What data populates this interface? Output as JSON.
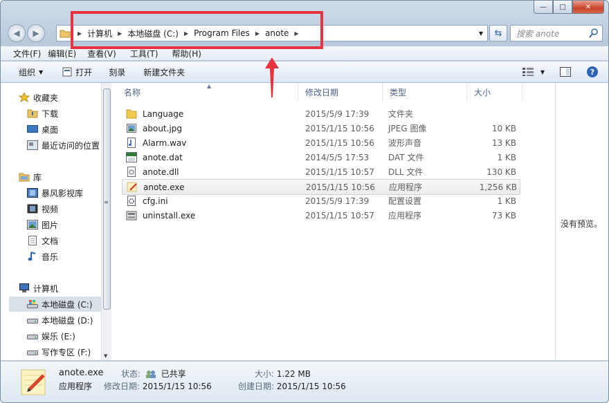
{
  "window": {
    "min": "—",
    "max": "□",
    "close": "✕"
  },
  "address": {
    "crumbs": [
      "计算机",
      "本地磁盘 (C:)",
      "Program Files",
      "anote"
    ]
  },
  "search": {
    "placeholder": "搜索 anote"
  },
  "menu": [
    "文件(F)",
    "编辑(E)",
    "查看(V)",
    "工具(T)",
    "帮助(H)"
  ],
  "toolbar": {
    "organize": "组织",
    "open": "打开",
    "burn": "刻录",
    "new_folder": "新建文件夹"
  },
  "nav": {
    "favorites": {
      "label": "收藏夹",
      "items": [
        "下载",
        "桌面",
        "最近访问的位置"
      ]
    },
    "libraries": {
      "label": "库",
      "items": [
        "暴风影视库",
        "视频",
        "图片",
        "文档",
        "音乐"
      ]
    },
    "computer": {
      "label": "计算机",
      "items": [
        "本地磁盘 (C:)",
        "本地磁盘 (D:)",
        "娱乐 (E:)",
        "写作专区 (F:)"
      ]
    }
  },
  "columns": [
    "名称",
    "修改日期",
    "类型",
    "大小"
  ],
  "files": [
    {
      "name": "Language",
      "date": "2015/5/9 17:39",
      "type": "文件夹",
      "size": "",
      "icon": "folder-icon"
    },
    {
      "name": "about.jpg",
      "date": "2015/1/15 10:56",
      "type": "JPEG 图像",
      "size": "10 KB",
      "icon": "image-file-icon"
    },
    {
      "name": "Alarm.wav",
      "date": "2015/1/15 10:56",
      "type": "波形声音",
      "size": "13 KB",
      "icon": "audio-file-icon"
    },
    {
      "name": "anote.dat",
      "date": "2014/5/5 17:53",
      "type": "DAT 文件",
      "size": "1 KB",
      "icon": "dat-file-icon"
    },
    {
      "name": "anote.dll",
      "date": "2015/1/15 10:57",
      "type": "DLL 文件",
      "size": "130 KB",
      "icon": "dll-file-icon"
    },
    {
      "name": "anote.exe",
      "date": "2015/1/15 10:56",
      "type": "应用程序",
      "size": "1,256 KB",
      "icon": "anote-app-icon"
    },
    {
      "name": "cfg.ini",
      "date": "2015/5/9 17:39",
      "type": "配置设置",
      "size": "1 KB",
      "icon": "ini-file-icon"
    },
    {
      "name": "uninstall.exe",
      "date": "2015/1/15 10:57",
      "type": "应用程序",
      "size": "73 KB",
      "icon": "uninstall-icon"
    }
  ],
  "preview": {
    "text": "没有预览。"
  },
  "status": {
    "filename": "anote.exe",
    "filetype": "应用程序",
    "state_label": "状态:",
    "state_value": "已共享",
    "modified_label": "修改日期:",
    "modified_value": "2015/1/15 10:56",
    "size_label": "大小:",
    "size_value": "1.22 MB",
    "created_label": "创建日期:",
    "created_value": "2015/1/15 10:56"
  },
  "colors": {
    "highlight": "#e8323e",
    "header_text": "#4d6185"
  }
}
